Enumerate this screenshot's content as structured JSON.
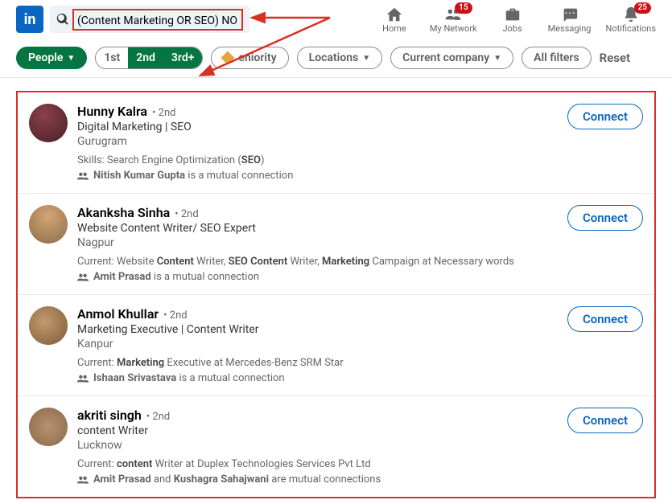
{
  "search": {
    "query": "(Content Marketing OR SEO) NO"
  },
  "nav": {
    "home": "Home",
    "network": "My Network",
    "network_badge": "15",
    "jobs": "Jobs",
    "messaging": "Messaging",
    "notifications": "Notifications",
    "notif_badge": "25"
  },
  "filters": {
    "people": "People",
    "conn1": "1st",
    "conn2": "2nd",
    "conn3": "3rd+",
    "seniority": "eniority",
    "locations": "Locations",
    "company": "Current company",
    "all": "All filters",
    "reset": "Reset"
  },
  "results": [
    {
      "name": "Hunny Kalra",
      "degree": "• 2nd",
      "headline": "Digital Marketing | SEO",
      "location": "Gurugram",
      "meta_html": "Skills: Search Engine Optimization (<b>SEO</b>)",
      "mutual_html": "<b>Nitish Kumar Gupta</b> is a mutual connection",
      "connect": "Connect"
    },
    {
      "name": "Akanksha Sinha",
      "degree": "• 2nd",
      "headline": "Website Content Writer/ SEO Expert",
      "location": "Nagpur",
      "meta_html": "Current: Website <b>Content</b> Writer, <b>SEO Content</b> Writer, <b>Marketing</b> Campaign at Necessary words",
      "mutual_html": "<b>Amit Prasad</b> is a mutual connection",
      "connect": "Connect"
    },
    {
      "name": "Anmol Khullar",
      "degree": "• 2nd",
      "headline": "Marketing Executive | Content Writer",
      "location": "Kanpur",
      "meta_html": "Current: <b>Marketing</b> Executive at Mercedes-Benz SRM Star",
      "mutual_html": "<b>Ishaan Srivastava</b> is a mutual connection",
      "connect": "Connect"
    },
    {
      "name": "akriti singh",
      "degree": "• 2nd",
      "headline": "content Writer",
      "location": "Lucknow",
      "meta_html": "Current: <b>content</b> Writer at Duplex Technologies Services Pvt Ltd",
      "mutual_html": "<b>Amit Prasad</b> and <b>Kushagra Sahajwani</b> are mutual connections",
      "connect": "Connect"
    }
  ]
}
